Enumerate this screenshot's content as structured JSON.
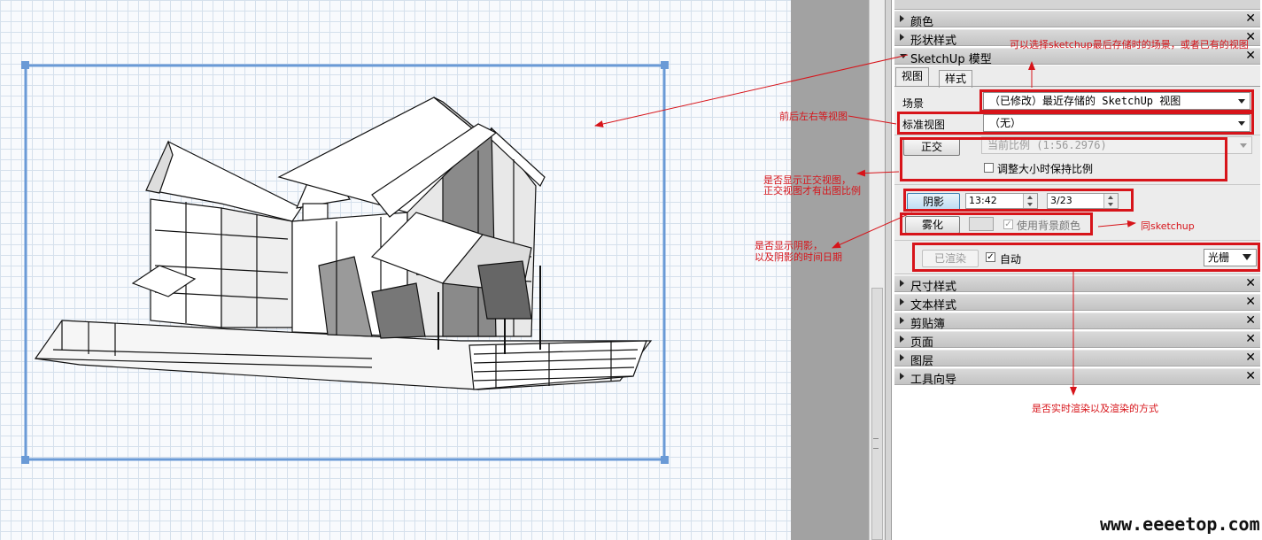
{
  "panel": {
    "sections_top": [
      {
        "label": "颜色"
      },
      {
        "label": "形状样式"
      },
      {
        "label": "SketchUp 模型"
      }
    ],
    "close_glyph": "✕",
    "model": {
      "tabs": [
        "视图",
        "样式"
      ],
      "scene_label": "场景",
      "scene_value": "（已修改）最近存储的 SketchUp 视图",
      "stdview_label": "标准视图",
      "stdview_value": "（无）",
      "ortho_button": "正交",
      "scale_value": "当前比例 (1:56.2976)",
      "keep_scale_label": "调整大小时保持比例",
      "shadow_button": "阴影",
      "time_value": "13:42",
      "date_value": "3/23",
      "fog_button": "雾化",
      "use_bg_label": "使用背景颜色",
      "render_button": "已渲染",
      "auto_label": "自动",
      "render_mode": "光栅"
    },
    "sections_bottom": [
      {
        "label": "尺寸样式"
      },
      {
        "label": "文本样式"
      },
      {
        "label": "剪贴簿"
      },
      {
        "label": "页面"
      },
      {
        "label": "图层"
      },
      {
        "label": "工具向导"
      }
    ]
  },
  "annotations": {
    "scene_note": "可以选择sketchup最后存储时的场景，或者已有的视图",
    "stdview_note": "前后左右等视图",
    "ortho_note_1": "是否显示正交视图，",
    "ortho_note_2": "正交视图才有出图比例",
    "fog_note": "同sketchup",
    "shadow_note_1": "是否显示阴影，",
    "shadow_note_2": "以及阴影的时间日期",
    "render_note": "是否实时渲染以及渲染的方式"
  },
  "watermark": "www.eeeetop.com",
  "colors": {
    "annotation": "#d7141a",
    "viewport_frame": "#6a9ad6"
  }
}
